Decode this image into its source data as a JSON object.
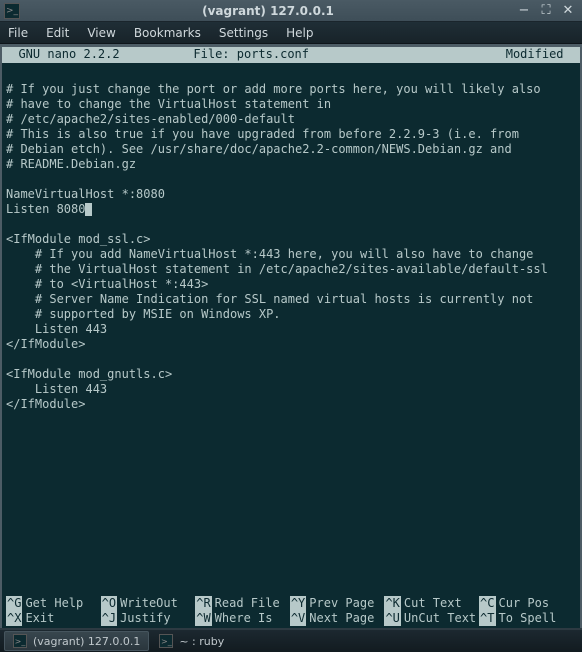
{
  "titlebar": {
    "title": "(vagrant) 127.0.0.1"
  },
  "menubar": {
    "file": "File",
    "edit": "Edit",
    "view": "View",
    "bookmarks": "Bookmarks",
    "settings": "Settings",
    "help": "Help"
  },
  "nano_header": {
    "left": "  GNU nano 2.2.2",
    "mid": "File: ports.conf",
    "right": "Modified  "
  },
  "editor_lines": [
    "",
    "# If you just change the port or add more ports here, you will likely also",
    "# have to change the VirtualHost statement in",
    "# /etc/apache2/sites-enabled/000-default",
    "# This is also true if you have upgraded from before 2.2.9-3 (i.e. from",
    "# Debian etch). See /usr/share/doc/apache2.2-common/NEWS.Debian.gz and",
    "# README.Debian.gz",
    "",
    "NameVirtualHost *:8080",
    "Listen 8080",
    "",
    "<IfModule mod_ssl.c>",
    "    # If you add NameVirtualHost *:443 here, you will also have to change",
    "    # the VirtualHost statement in /etc/apache2/sites-available/default-ssl",
    "    # to <VirtualHost *:443>",
    "    # Server Name Indication for SSL named virtual hosts is currently not",
    "    # supported by MSIE on Windows XP.",
    "    Listen 443",
    "</IfModule>",
    "",
    "<IfModule mod_gnutls.c>",
    "    Listen 443",
    "</IfModule>"
  ],
  "cursor_line": 9,
  "shortcuts": {
    "row1": [
      {
        "key": "^G",
        "label": "Get Help"
      },
      {
        "key": "^O",
        "label": "WriteOut"
      },
      {
        "key": "^R",
        "label": "Read File"
      },
      {
        "key": "^Y",
        "label": "Prev Page"
      },
      {
        "key": "^K",
        "label": "Cut Text"
      },
      {
        "key": "^C",
        "label": "Cur Pos"
      }
    ],
    "row2": [
      {
        "key": "^X",
        "label": "Exit"
      },
      {
        "key": "^J",
        "label": "Justify"
      },
      {
        "key": "^W",
        "label": "Where Is"
      },
      {
        "key": "^V",
        "label": "Next Page"
      },
      {
        "key": "^U",
        "label": "UnCut Text"
      },
      {
        "key": "^T",
        "label": "To Spell"
      }
    ]
  },
  "taskbar": {
    "items": [
      {
        "label": "(vagrant) 127.0.0.1",
        "active": true
      },
      {
        "label": "~ : ruby",
        "active": false
      }
    ]
  }
}
